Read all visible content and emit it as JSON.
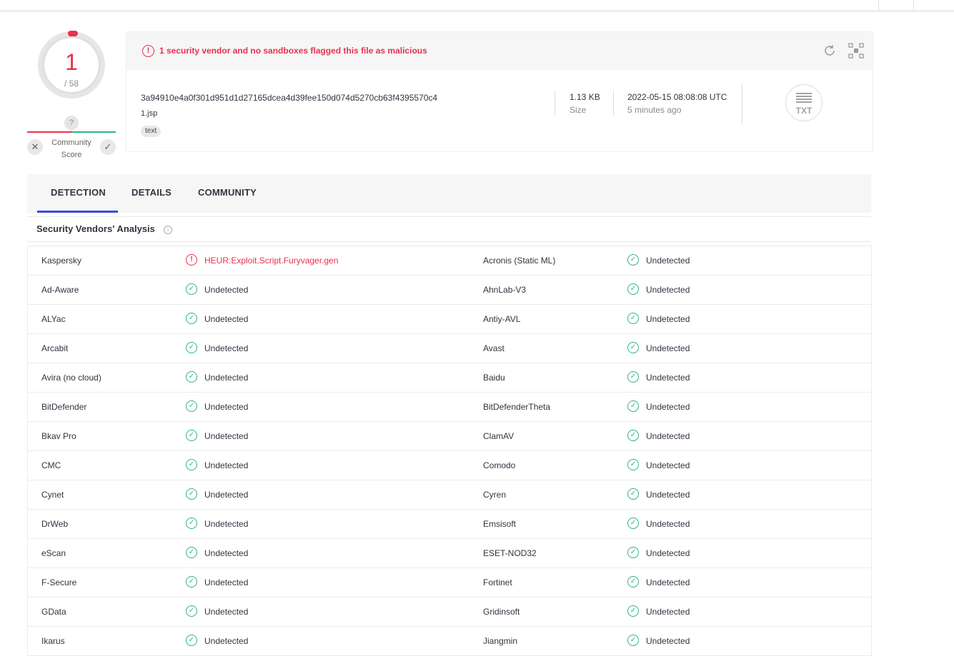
{
  "score": {
    "detections": "1",
    "total": "/ 58"
  },
  "community": {
    "question_glyph": "?",
    "label": "Community Score",
    "downvote_glyph": "✕",
    "upvote_glyph": "✓"
  },
  "alert": {
    "text": "1 security vendor and no sandboxes flagged this file as malicious"
  },
  "file": {
    "hash": "3a94910e4a0f301d951d1d27165dcea4d39fee150d074d5270cb63f4395570c4",
    "name": "1.jsp",
    "tag": "text",
    "size_value": "1.13 KB",
    "size_label": "Size",
    "date": "2022-05-15 08:08:08 UTC",
    "date_ago": "5 minutes ago",
    "type_label": "TXT"
  },
  "tabs": [
    {
      "label": "DETECTION",
      "active": true
    },
    {
      "label": "DETAILS",
      "active": false
    },
    {
      "label": "COMMUNITY",
      "active": false
    }
  ],
  "section": {
    "title": "Security Vendors' Analysis"
  },
  "vendors": [
    {
      "left": {
        "name": "Kaspersky",
        "result": "HEUR:Exploit.Script.Furyvager.gen",
        "malicious": true
      },
      "right": {
        "name": "Acronis (Static ML)",
        "result": "Undetected",
        "malicious": false
      }
    },
    {
      "left": {
        "name": "Ad-Aware",
        "result": "Undetected",
        "malicious": false
      },
      "right": {
        "name": "AhnLab-V3",
        "result": "Undetected",
        "malicious": false
      }
    },
    {
      "left": {
        "name": "ALYac",
        "result": "Undetected",
        "malicious": false
      },
      "right": {
        "name": "Antiy-AVL",
        "result": "Undetected",
        "malicious": false
      }
    },
    {
      "left": {
        "name": "Arcabit",
        "result": "Undetected",
        "malicious": false
      },
      "right": {
        "name": "Avast",
        "result": "Undetected",
        "malicious": false
      }
    },
    {
      "left": {
        "name": "Avira (no cloud)",
        "result": "Undetected",
        "malicious": false
      },
      "right": {
        "name": "Baidu",
        "result": "Undetected",
        "malicious": false
      }
    },
    {
      "left": {
        "name": "BitDefender",
        "result": "Undetected",
        "malicious": false
      },
      "right": {
        "name": "BitDefenderTheta",
        "result": "Undetected",
        "malicious": false
      }
    },
    {
      "left": {
        "name": "Bkav Pro",
        "result": "Undetected",
        "malicious": false
      },
      "right": {
        "name": "ClamAV",
        "result": "Undetected",
        "malicious": false
      }
    },
    {
      "left": {
        "name": "CMC",
        "result": "Undetected",
        "malicious": false
      },
      "right": {
        "name": "Comodo",
        "result": "Undetected",
        "malicious": false
      }
    },
    {
      "left": {
        "name": "Cynet",
        "result": "Undetected",
        "malicious": false
      },
      "right": {
        "name": "Cyren",
        "result": "Undetected",
        "malicious": false
      }
    },
    {
      "left": {
        "name": "DrWeb",
        "result": "Undetected",
        "malicious": false
      },
      "right": {
        "name": "Emsisoft",
        "result": "Undetected",
        "malicious": false
      }
    },
    {
      "left": {
        "name": "eScan",
        "result": "Undetected",
        "malicious": false
      },
      "right": {
        "name": "ESET-NOD32",
        "result": "Undetected",
        "malicious": false
      }
    },
    {
      "left": {
        "name": "F-Secure",
        "result": "Undetected",
        "malicious": false
      },
      "right": {
        "name": "Fortinet",
        "result": "Undetected",
        "malicious": false
      }
    },
    {
      "left": {
        "name": "GData",
        "result": "Undetected",
        "malicious": false
      },
      "right": {
        "name": "Gridinsoft",
        "result": "Undetected",
        "malicious": false
      }
    },
    {
      "left": {
        "name": "Ikarus",
        "result": "Undetected",
        "malicious": false
      },
      "right": {
        "name": "Jiangmin",
        "result": "Undetected",
        "malicious": false
      }
    }
  ],
  "icons": {
    "ok": "check-circle-icon",
    "bad": "alert-circle-icon",
    "refresh": "refresh-icon",
    "qr": "qr-scan-icon",
    "info": "info-icon",
    "file_type": "txt-file-icon"
  },
  "colors": {
    "malicious": "#e8314d",
    "clean": "#2fb57e",
    "accent": "#3b48de"
  }
}
